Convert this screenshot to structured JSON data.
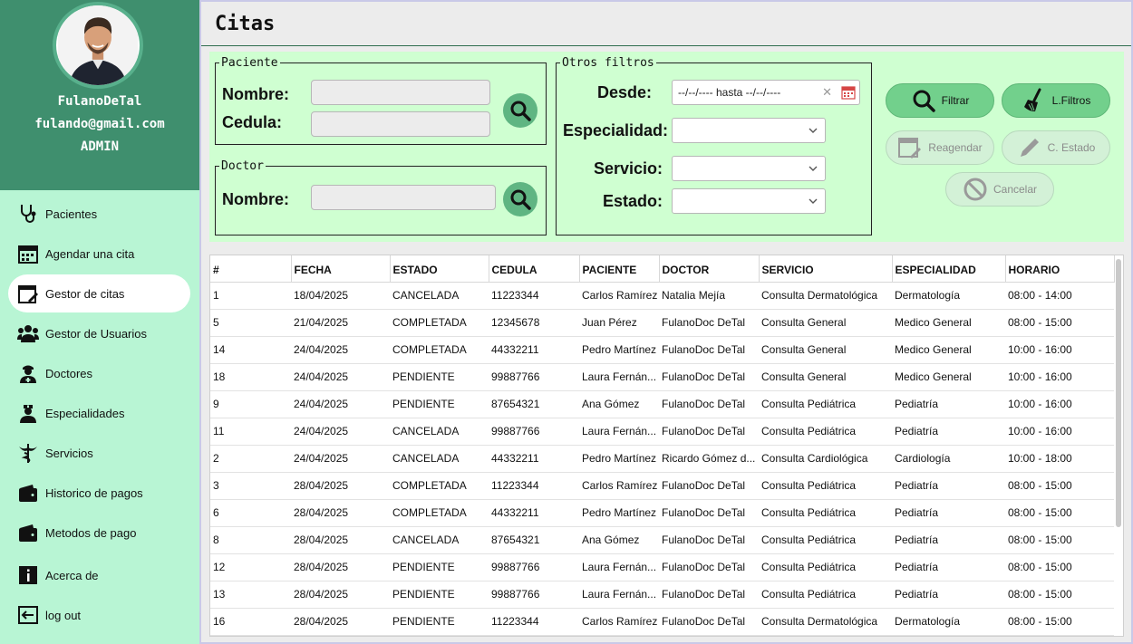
{
  "user": {
    "name": "FulanoDeTal",
    "email": "fulando@gmail.com",
    "role": "ADMIN"
  },
  "nav": [
    {
      "label": "Pacientes",
      "icon": "stethoscope-icon"
    },
    {
      "label": "Agendar una cita",
      "icon": "calendar-icon"
    },
    {
      "label": "Gestor de citas",
      "icon": "calendar-edit-icon",
      "active": true
    },
    {
      "label": "Gestor de Usuarios",
      "icon": "users-icon"
    },
    {
      "label": "Doctores",
      "icon": "doctor-icon"
    },
    {
      "label": "Especialidades",
      "icon": "nurse-icon"
    },
    {
      "label": "Servicios",
      "icon": "caduceus-icon"
    },
    {
      "label": "Historico de pagos",
      "icon": "wallet-icon"
    },
    {
      "label": "Metodos de pago",
      "icon": "wallet-icon"
    },
    {
      "label": "Acerca de",
      "icon": "info-icon"
    },
    {
      "label": "log out",
      "icon": "logout-icon"
    }
  ],
  "page": {
    "title": "Citas"
  },
  "filters": {
    "paciente": {
      "legend": "Paciente",
      "nombre_label": "Nombre:",
      "nombre_value": "",
      "cedula_label": "Cedula:",
      "cedula_value": ""
    },
    "doctor": {
      "legend": "Doctor",
      "nombre_label": "Nombre:",
      "nombre_value": ""
    },
    "otros": {
      "legend": "Otros filtros",
      "desde_label": "Desde:",
      "date_range_value": "--/--/---- hasta --/--/----",
      "especialidad_label": "Especialidad:",
      "especialidad_value": "",
      "servicio_label": "Servicio:",
      "servicio_value": "",
      "estado_label": "Estado:",
      "estado_value": ""
    }
  },
  "actions": {
    "filtrar": "Filtrar",
    "limpiar": "L.Filtros",
    "reagendar": "Reagendar",
    "cambiar_estado": "C. Estado",
    "cancelar": "Cancelar"
  },
  "colors": {
    "sidebar_bg": "#b8f5d4",
    "profile_bg": "#3f8f6e",
    "filter_panel_bg": "#cfffd1",
    "button_active": "#72d08c",
    "button_disabled": "#d3f1d7",
    "search_button": "#5fb582"
  },
  "table": {
    "columns": [
      "#",
      "FECHA",
      "ESTADO",
      "CEDULA",
      "PACIENTE",
      "DOCTOR",
      "SERVICIO",
      "ESPECIALIDAD",
      "HORARIO"
    ],
    "rows": [
      [
        "1",
        "18/04/2025",
        "CANCELADA",
        "11223344",
        "Carlos Ramírez",
        "Natalia Mejía",
        "Consulta Dermatológica",
        "Dermatología",
        "08:00 - 14:00"
      ],
      [
        "5",
        "21/04/2025",
        "COMPLETADA",
        "12345678",
        "Juan Pérez",
        "FulanoDoc DeTal",
        "Consulta General",
        "Medico General",
        "08:00 - 15:00"
      ],
      [
        "14",
        "24/04/2025",
        "COMPLETADA",
        "44332211",
        "Pedro Martínez",
        "FulanoDoc DeTal",
        "Consulta General",
        "Medico General",
        "10:00 - 16:00"
      ],
      [
        "18",
        "24/04/2025",
        "PENDIENTE",
        "99887766",
        "Laura Fernán...",
        "FulanoDoc DeTal",
        "Consulta General",
        "Medico General",
        "10:00 - 16:00"
      ],
      [
        "9",
        "24/04/2025",
        "PENDIENTE",
        "87654321",
        "Ana Gómez",
        "FulanoDoc DeTal",
        "Consulta Pediátrica",
        "Pediatría",
        "10:00 - 16:00"
      ],
      [
        "11",
        "24/04/2025",
        "CANCELADA",
        "99887766",
        "Laura Fernán...",
        "FulanoDoc DeTal",
        "Consulta Pediátrica",
        "Pediatría",
        "10:00 - 16:00"
      ],
      [
        "2",
        "24/04/2025",
        "CANCELADA",
        "44332211",
        "Pedro Martínez",
        "Ricardo Gómez d...",
        "Consulta Cardiológica",
        "Cardiología",
        "10:00 - 18:00"
      ],
      [
        "3",
        "28/04/2025",
        "COMPLETADA",
        "11223344",
        "Carlos Ramírez",
        "FulanoDoc DeTal",
        "Consulta Pediátrica",
        "Pediatría",
        "08:00 - 15:00"
      ],
      [
        "6",
        "28/04/2025",
        "COMPLETADA",
        "44332211",
        "Pedro Martínez",
        "FulanoDoc DeTal",
        "Consulta Pediátrica",
        "Pediatría",
        "08:00 - 15:00"
      ],
      [
        "8",
        "28/04/2025",
        "CANCELADA",
        "87654321",
        "Ana Gómez",
        "FulanoDoc DeTal",
        "Consulta Pediátrica",
        "Pediatría",
        "08:00 - 15:00"
      ],
      [
        "12",
        "28/04/2025",
        "PENDIENTE",
        "99887766",
        "Laura Fernán...",
        "FulanoDoc DeTal",
        "Consulta Pediátrica",
        "Pediatría",
        "08:00 - 15:00"
      ],
      [
        "13",
        "28/04/2025",
        "PENDIENTE",
        "99887766",
        "Laura Fernán...",
        "FulanoDoc DeTal",
        "Consulta Pediátrica",
        "Pediatría",
        "08:00 - 15:00"
      ],
      [
        "16",
        "28/04/2025",
        "PENDIENTE",
        "11223344",
        "Carlos Ramírez",
        "FulanoDoc DeTal",
        "Consulta Dermatológica",
        "Dermatología",
        "08:00 - 15:00"
      ]
    ]
  }
}
